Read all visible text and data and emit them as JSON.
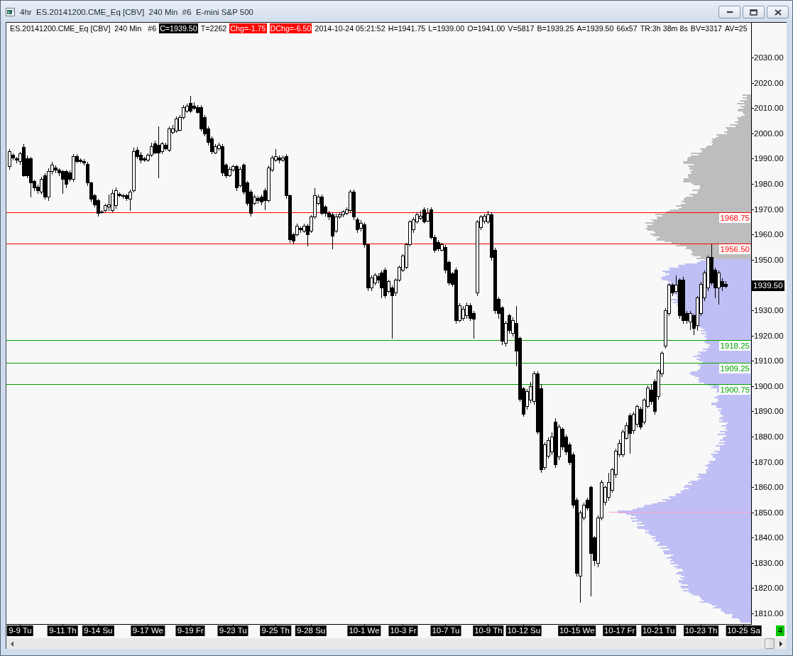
{
  "window": {
    "title": "4hr  ES.20141200.CME_Eq [CBV]  240 Min  #6  E-mini S&P 500"
  },
  "header": [
    {
      "text": "ES.20141200.CME_Eq [CBV]  240 Min   #6",
      "kind": "plain"
    },
    {
      "text": "C=1939.50",
      "kind": "inverse"
    },
    {
      "text": "T=2262",
      "kind": "plain"
    },
    {
      "text": "Chg=-1.75",
      "kind": "alert"
    },
    {
      "text": "DChg=-6.50",
      "kind": "alert"
    },
    {
      "text": "2014-10-24 05:21:52",
      "kind": "plain"
    },
    {
      "text": "H=1941.75",
      "kind": "plain"
    },
    {
      "text": "L=1939.00",
      "kind": "plain"
    },
    {
      "text": "O=1941.00",
      "kind": "plain"
    },
    {
      "text": "V=5817",
      "kind": "plain"
    },
    {
      "text": "B=1939.25",
      "kind": "plain"
    },
    {
      "text": "A=1939.50",
      "kind": "plain"
    },
    {
      "text": "66x57",
      "kind": "plain"
    },
    {
      "text": "TR:3h 38m 8s",
      "kind": "plain"
    },
    {
      "text": "BV=3317",
      "kind": "plain"
    },
    {
      "text": "AV=25",
      "kind": "plain"
    }
  ],
  "chart": {
    "chart_data": {
      "type": "candlestick",
      "categories": [
        null,
        null,
        null,
        "9-9 Tu",
        null,
        null,
        null,
        null,
        null,
        null,
        null,
        null,
        null,
        null,
        null,
        "9-11 Th",
        null,
        null,
        null,
        null,
        null,
        null,
        null,
        null,
        null,
        "9-14 Su",
        null,
        null,
        null,
        null,
        null,
        null,
        null,
        null,
        null,
        null,
        null,
        null,
        null,
        "9-17 We",
        null,
        null,
        null,
        null,
        null,
        null,
        null,
        null,
        null,
        null,
        null,
        "9-19 Fr",
        null,
        null,
        null,
        null,
        null,
        null,
        null,
        null,
        null,
        null,
        null,
        "9-23 Tu",
        null,
        null,
        null,
        null,
        null,
        null,
        null,
        null,
        null,
        null,
        null,
        "9-25 Th",
        null,
        null,
        null,
        null,
        null,
        null,
        null,
        null,
        null,
        "9-28 Su",
        null,
        null,
        null,
        null,
        null,
        null,
        null,
        null,
        null,
        null,
        null,
        null,
        null,
        null,
        "10-1 We",
        null,
        null,
        null,
        null,
        null,
        null,
        null,
        null,
        null,
        null,
        "10-3 Fr",
        null,
        null,
        null,
        null,
        null,
        null,
        null,
        null,
        null,
        null,
        null,
        "10-7 Tu",
        null,
        null,
        null,
        null,
        null,
        null,
        null,
        null,
        null,
        null,
        null,
        "10-9 Th",
        null,
        null,
        null,
        null,
        null,
        null,
        null,
        null,
        null,
        "10-12 Su",
        null,
        null,
        null,
        null,
        null,
        null,
        null,
        null,
        null,
        null,
        null,
        null,
        null,
        null,
        "10-15 We",
        null,
        null,
        null,
        null,
        null,
        null,
        null,
        null,
        null,
        null,
        null,
        "10-17 Fr",
        null,
        null,
        null,
        null,
        null,
        null,
        null,
        null,
        null,
        null,
        "10-21 Tu",
        null,
        null,
        null,
        null,
        null,
        null,
        null,
        null,
        null,
        null,
        null,
        "10-23 Th",
        null,
        null,
        null,
        null,
        null,
        null,
        null,
        null,
        null,
        null,
        null,
        "10-25 Sa"
      ],
      "ohlc": [
        [
          1987,
          1994,
          1986,
          1993
        ],
        [
          1991.5,
          1992.5,
          1989.5,
          1990.5
        ],
        [
          1990,
          1991,
          1988.5,
          1989.5
        ],
        [
          1989,
          1993,
          1988,
          1992
        ],
        [
          1994.5,
          1996,
          1983,
          1983.5
        ],
        [
          1990,
          1991.5,
          1982.5,
          1983.5
        ],
        [
          1990,
          1991,
          1975,
          1980.5
        ],
        [
          1981,
          1982,
          1977.5,
          1978.5
        ],
        [
          1979,
          1980,
          1976.5,
          1977.5
        ],
        [
          1977,
          1983,
          1976,
          1982
        ],
        [
          1983.5,
          1984.5,
          1974,
          1975
        ],
        [
          1975,
          1986.5,
          1973.5,
          1985
        ],
        [
          1985,
          1989,
          1984,
          1987.5
        ],
        [
          1986.5,
          1987.5,
          1984.5,
          1985.5
        ],
        [
          1985.5,
          1986.5,
          1983.5,
          1984.5
        ],
        [
          1985,
          1986,
          1976.5,
          1982
        ],
        [
          1985,
          1986,
          1978.5,
          1980
        ],
        [
          1984.5,
          1985.5,
          1981,
          1982
        ],
        [
          1982,
          1992,
          1981,
          1991
        ],
        [
          1991,
          1992,
          1988.5,
          1989
        ],
        [
          1989.5,
          1990.5,
          1988.5,
          1989
        ],
        [
          1989,
          1990,
          1987.5,
          1988.5
        ],
        [
          1988,
          1989,
          1979.5,
          1980.5
        ],
        [
          1980.5,
          1981,
          1973,
          1974
        ],
        [
          1975.5,
          1976.5,
          1971,
          1972
        ],
        [
          1973.5,
          1974.5,
          1967.5,
          1968.5
        ],
        [
          1969,
          1970,
          1968.5,
          1968.75
        ],
        [
          1969.5,
          1972.5,
          1969,
          1971.5
        ],
        [
          1971,
          1976,
          1969.5,
          1972
        ],
        [
          1969.5,
          1978,
          1969,
          1976.5
        ],
        [
          1971.5,
          1979,
          1970.5,
          1977.5
        ],
        [
          1976,
          1977,
          1975,
          1975.5
        ],
        [
          1975.5,
          1976.5,
          1974.5,
          1975.25
        ],
        [
          1975.5,
          1976.5,
          1973.5,
          1974.5
        ],
        [
          1974,
          1978,
          1969.5,
          1977
        ],
        [
          1977.5,
          1994.5,
          1977,
          1993
        ],
        [
          1993.5,
          1995,
          1990,
          1991
        ],
        [
          1991.5,
          1993,
          1988.5,
          1989.5
        ],
        [
          1990,
          1991,
          1989,
          1989.5
        ],
        [
          1989.5,
          1992.5,
          1989,
          1991.5
        ],
        [
          1991.5,
          1996.5,
          1991,
          1995
        ],
        [
          1996,
          1997.5,
          1992,
          1992.5
        ],
        [
          1995.5,
          2003,
          1982.5,
          1992.5
        ],
        [
          1993,
          1997,
          1992,
          1996
        ],
        [
          1995.5,
          1996.5,
          1993.5,
          1994
        ],
        [
          1993.5,
          2003,
          1993,
          2002
        ],
        [
          2000.5,
          2003.5,
          2000,
          2002
        ],
        [
          2001,
          2007,
          2000.5,
          2006
        ],
        [
          2001.5,
          2007.5,
          2001,
          2006.5
        ],
        [
          2006.5,
          2011.5,
          2006,
          2010.5
        ],
        [
          2009,
          2012,
          2008.5,
          2011
        ],
        [
          2012,
          2015,
          2008.5,
          2009
        ],
        [
          2011,
          2012.5,
          2009.5,
          2010
        ],
        [
          2010.5,
          2011.5,
          2008,
          2008.5
        ],
        [
          2010.5,
          2011.5,
          2001,
          2002
        ],
        [
          2006.5,
          2007.5,
          1999,
          2000
        ],
        [
          2002,
          2003,
          1995.5,
          1996.5
        ],
        [
          1998,
          1999,
          1992,
          1993
        ],
        [
          1992.5,
          1996,
          1992,
          1995
        ],
        [
          1994,
          1996.5,
          1993.5,
          1995.5
        ],
        [
          1995,
          1996,
          1983.5,
          1984.5
        ],
        [
          1987.5,
          1988.5,
          1982.5,
          1983.5
        ],
        [
          1983.5,
          1987,
          1983,
          1986
        ],
        [
          1985.5,
          1988,
          1985,
          1987
        ],
        [
          1987,
          1988,
          1977.5,
          1978.5
        ],
        [
          1979.5,
          1987,
          1979,
          1986
        ],
        [
          1987.5,
          1988.5,
          1976,
          1977
        ],
        [
          1980.5,
          1981.5,
          1971.5,
          1972.5
        ],
        [
          1977,
          1978,
          1967.5,
          1968.5
        ],
        [
          1972.5,
          1976,
          1972,
          1975
        ],
        [
          1974.5,
          1975.5,
          1972.5,
          1973.5
        ],
        [
          1975,
          1976,
          1972,
          1973
        ],
        [
          1977.5,
          1978.5,
          1970,
          1973.5
        ],
        [
          1973.5,
          1987.5,
          1973,
          1986.5
        ],
        [
          1985.5,
          1991.5,
          1985,
          1990.5
        ],
        [
          1989.5,
          1994,
          1989,
          1991
        ],
        [
          1990.5,
          1991.5,
          1988.5,
          1989.5
        ],
        [
          1989.5,
          1991.5,
          1989,
          1990.5
        ],
        [
          1991,
          1992,
          1974.5,
          1975.5
        ],
        [
          1975.5,
          1976,
          1957,
          1958
        ],
        [
          1960,
          1961,
          1956.5,
          1957.5
        ],
        [
          1960,
          1964.5,
          1959.5,
          1963.5
        ],
        [
          1962.5,
          1963.5,
          1961,
          1962
        ],
        [
          1961.5,
          1964.5,
          1961,
          1963.5
        ],
        [
          1963.5,
          1964.5,
          1955.5,
          1960
        ],
        [
          1961.5,
          1968,
          1961,
          1967
        ],
        [
          1967,
          1978.5,
          1966.5,
          1975.5
        ],
        [
          1972.5,
          1976,
          1972,
          1975
        ],
        [
          1975,
          1976,
          1968,
          1968.5
        ],
        [
          1971,
          1972,
          1967.5,
          1968.5
        ],
        [
          1968.5,
          1969.5,
          1966,
          1967
        ],
        [
          1968,
          1969,
          1954.5,
          1959.5
        ],
        [
          1961.5,
          1968.5,
          1961,
          1967
        ],
        [
          1967,
          1969,
          1966.5,
          1968
        ],
        [
          1968,
          1970,
          1967,
          1969
        ],
        [
          1968.5,
          1971,
          1968,
          1970
        ],
        [
          1969.5,
          1978,
          1969,
          1977
        ],
        [
          1977,
          1978,
          1966,
          1967
        ],
        [
          1966,
          1967,
          1961,
          1962
        ],
        [
          1962.5,
          1966,
          1961.5,
          1964.5
        ],
        [
          1964,
          1965,
          1955,
          1956
        ],
        [
          1956,
          1956.5,
          1938,
          1939
        ],
        [
          1939,
          1944,
          1938,
          1943
        ],
        [
          1941,
          1945,
          1940,
          1944
        ],
        [
          1943.5,
          1945,
          1941,
          1942
        ],
        [
          1945,
          1946,
          1935,
          1939
        ],
        [
          1946,
          1947,
          1935,
          1936
        ],
        [
          1937.5,
          1942.5,
          1937,
          1941.5
        ],
        [
          1939,
          1940,
          1919,
          1936
        ],
        [
          1937,
          1943,
          1936,
          1942
        ],
        [
          1942,
          1948,
          1941.5,
          1947
        ],
        [
          1946,
          1952.5,
          1945.5,
          1951.5
        ],
        [
          1947,
          1957,
          1946.5,
          1956
        ],
        [
          1956,
          1966,
          1955.5,
          1965
        ],
        [
          1962,
          1967,
          1961,
          1966
        ],
        [
          1965,
          1969,
          1964.5,
          1968
        ],
        [
          1966.5,
          1969.5,
          1966,
          1967.5
        ],
        [
          1970,
          1971,
          1964.5,
          1965
        ],
        [
          1965.5,
          1970.75,
          1965,
          1968.5
        ],
        [
          1970,
          1971,
          1958.5,
          1959
        ],
        [
          1959,
          1960,
          1953,
          1954
        ],
        [
          1957,
          1958,
          1953.5,
          1954.5
        ],
        [
          1954,
          1957,
          1953.5,
          1956
        ],
        [
          1955,
          1956,
          1945,
          1946
        ],
        [
          1949,
          1950,
          1940,
          1941
        ],
        [
          1944.5,
          1945.5,
          1939.5,
          1940.5
        ],
        [
          1946,
          1947,
          1925,
          1926
        ],
        [
          1926,
          1933,
          1925.5,
          1932
        ],
        [
          1927,
          1932,
          1926,
          1930.5
        ],
        [
          1928,
          1933.5,
          1927,
          1932
        ],
        [
          1932,
          1933,
          1926,
          1927
        ],
        [
          1929,
          1930,
          1919,
          1926.5
        ],
        [
          1937,
          1966,
          1936,
          1965
        ],
        [
          1963,
          1968,
          1962,
          1967
        ],
        [
          1965.5,
          1968.5,
          1964.5,
          1967.5
        ],
        [
          1965,
          1969.5,
          1964.5,
          1968
        ],
        [
          1968,
          1969,
          1950,
          1951
        ],
        [
          1954,
          1955,
          1929,
          1930
        ],
        [
          1934.5,
          1935.5,
          1927,
          1929
        ],
        [
          1931,
          1932,
          1916.5,
          1918
        ],
        [
          1917,
          1926,
          1916,
          1925
        ],
        [
          1928,
          1929,
          1921,
          1922
        ],
        [
          1921,
          1927.5,
          1920,
          1926
        ],
        [
          1925,
          1932,
          1908,
          1914
        ],
        [
          1919,
          1920,
          1894,
          1895
        ],
        [
          1899,
          1900,
          1888,
          1889
        ],
        [
          1892,
          1899,
          1891,
          1898
        ],
        [
          1894.5,
          1902,
          1893.5,
          1900
        ],
        [
          1894,
          1906,
          1893,
          1905
        ],
        [
          1905,
          1906,
          1881,
          1882
        ],
        [
          1899,
          1901,
          1866,
          1867
        ],
        [
          1868,
          1878,
          1867,
          1877
        ],
        [
          1872.5,
          1880,
          1871.5,
          1878.5
        ],
        [
          1874,
          1882,
          1873,
          1880
        ],
        [
          1886,
          1887.5,
          1868,
          1869
        ],
        [
          1872,
          1885,
          1871,
          1884
        ],
        [
          1883,
          1884,
          1875,
          1876
        ],
        [
          1880,
          1881,
          1873,
          1874
        ],
        [
          1877,
          1878,
          1869,
          1870
        ],
        [
          1873,
          1874,
          1852,
          1853
        ],
        [
          1855,
          1856,
          1825,
          1826
        ],
        [
          1825,
          1851,
          1814.5,
          1850
        ],
        [
          1848,
          1854,
          1847,
          1853
        ],
        [
          1855,
          1856,
          1851,
          1852
        ],
        [
          1860,
          1861,
          1817,
          1834
        ],
        [
          1840,
          1841,
          1829,
          1831
        ],
        [
          1830,
          1849,
          1828.5,
          1848
        ],
        [
          1848,
          1863,
          1847,
          1862
        ],
        [
          1854,
          1861,
          1853,
          1860
        ],
        [
          1856,
          1866,
          1855,
          1862
        ],
        [
          1859,
          1868,
          1858,
          1867
        ],
        [
          1865,
          1875.5,
          1864,
          1874.5
        ],
        [
          1873,
          1879,
          1872,
          1877.5
        ],
        [
          1873,
          1883,
          1872,
          1882
        ],
        [
          1879.5,
          1886,
          1879,
          1884.5
        ],
        [
          1888.5,
          1889.5,
          1873.5,
          1881.5
        ],
        [
          1882.5,
          1890,
          1881.5,
          1889
        ],
        [
          1885,
          1893,
          1884,
          1892
        ],
        [
          1891,
          1892,
          1883,
          1884
        ],
        [
          1886,
          1895.5,
          1885,
          1894.5
        ],
        [
          1892,
          1900.5,
          1891.5,
          1899.5
        ],
        [
          1898.5,
          1901,
          1893,
          1894
        ],
        [
          1902,
          1903,
          1889,
          1890
        ],
        [
          1896,
          1907,
          1895,
          1906
        ],
        [
          1905,
          1914,
          1904,
          1913
        ],
        [
          1916,
          1931,
          1915,
          1930
        ],
        [
          1929,
          1941,
          1928,
          1940
        ],
        [
          1940,
          1941,
          1936,
          1937
        ],
        [
          1937.5,
          1944,
          1937,
          1940
        ],
        [
          1942,
          1943,
          1927,
          1928
        ],
        [
          1942,
          1943.5,
          1925,
          1926
        ],
        [
          1929,
          1930,
          1925,
          1926
        ],
        [
          1925.5,
          1930,
          1922.5,
          1929
        ],
        [
          1928,
          1929,
          1920.5,
          1923
        ],
        [
          1924,
          1936,
          1922,
          1935
        ],
        [
          1929,
          1941.5,
          1928,
          1940.5
        ],
        [
          1935,
          1946,
          1934,
          1945
        ],
        [
          1939,
          1952,
          1938,
          1951
        ],
        [
          1951,
          1956.5,
          1940,
          1941
        ],
        [
          1946,
          1947,
          1935,
          1939
        ],
        [
          1939,
          1946,
          1932.5,
          1945
        ],
        [
          1941.5,
          1943,
          1938,
          1939.5
        ],
        [
          1940.5,
          1941.75,
          1939,
          1939.5
        ],
        null,
        null,
        null,
        null,
        null
      ],
      "ylim": [
        1805.8,
        2043.8
      ],
      "yticks": [
        {
          "value": 2030,
          "label": "2030.00"
        },
        {
          "value": 2020,
          "label": "2020.00"
        },
        {
          "value": 2010,
          "label": "2010.00"
        },
        {
          "value": 2000,
          "label": "2000.00"
        },
        {
          "value": 1990,
          "label": "1990.00"
        },
        {
          "value": 1980,
          "label": "1980.00"
        },
        {
          "value": 1970,
          "label": "1970.00"
        },
        {
          "value": 1960,
          "label": "1960.00"
        },
        {
          "value": 1950,
          "label": "1950.00"
        },
        {
          "value": 1930,
          "label": "1930.00"
        },
        {
          "value": 1920,
          "label": "1920.00"
        },
        {
          "value": 1910,
          "label": "1910.00"
        },
        {
          "value": 1900,
          "label": "1900.00"
        },
        {
          "value": 1890,
          "label": "1890.00"
        },
        {
          "value": 1880,
          "label": "1880.00"
        },
        {
          "value": 1870,
          "label": "1870.00"
        },
        {
          "value": 1860,
          "label": "1860.00"
        },
        {
          "value": 1850,
          "label": "1850.00"
        },
        {
          "value": 1840,
          "label": "1840.00"
        },
        {
          "value": 1830,
          "label": "1830.00"
        },
        {
          "value": 1820,
          "label": "1820.00"
        },
        {
          "value": 1810,
          "label": "1810.00"
        }
      ],
      "ref_lines": [
        {
          "axis": "y",
          "value": 1968.75,
          "label": "1968.75",
          "color": "#ff0000"
        },
        {
          "axis": "y",
          "value": 1956.5,
          "label": "1956.50",
          "color": "#ff0000"
        },
        {
          "axis": "y",
          "value": 1918.25,
          "label": "1918.25",
          "color": "#00a000"
        },
        {
          "axis": "y",
          "value": 1909.25,
          "label": "1909.25",
          "color": "#00a000"
        },
        {
          "axis": "y",
          "value": 1900.75,
          "label": "1900.75",
          "color": "#00a000"
        }
      ],
      "annotations": [
        "1939.50"
      ]
    }
  },
  "corner_badge": "4"
}
